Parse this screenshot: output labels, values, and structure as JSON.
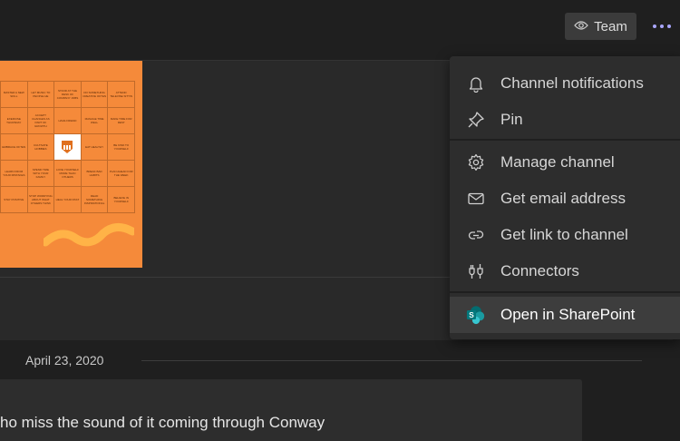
{
  "header": {
    "team_label": "Team"
  },
  "bingo": {
    "cells": [
      "MASTER A NEW SKILL",
      "LET MUSIC TO PEOPLE HE",
      "STAND AT THE DESK OF COMPANY JOBS",
      "DO SOMETHING CREATIVE OFTEN",
      "ATTEND TELEVISE SITTIN",
      "EXERCISE THURSDAY",
      "ACCEPT CHANGES AS PART OF GROWTH",
      "HAVE FRIEND",
      "MANAGE TIME WELL",
      "MAKE TIME FOR REST",
      "EMBRACE OFTEN",
      "CULTIVATE HOBBIES",
      "",
      "EAT HEALTHY",
      "BE KIND TO YOURSELF",
      "LEARN FROM YOUR MISTAKES",
      "SPEND TIME WITH YOUR FAMILY",
      "LOVE YOURSELF MORE THAN OTHERS",
      "BREAK BAD HABITS",
      "PLAN AHEAD FOR THE WEEK",
      "STAY POSITIVE",
      "STOP WORRYING ABOUT WHAT OTHERS THINK",
      "HEAL YOUR PAST",
      "READ SOMETHING INSPIRATIONAL",
      "BELIEVE IN YOURSELF"
    ]
  },
  "conversation": {
    "date": "April 23, 2020",
    "message_text": "ho miss the sound of it coming through Conway"
  },
  "menu": {
    "items": [
      {
        "label": "Channel notifications",
        "icon": "bell-icon"
      },
      {
        "label": "Pin",
        "icon": "pin-icon"
      },
      {
        "label": "Manage channel",
        "icon": "gear-icon"
      },
      {
        "label": "Get email address",
        "icon": "mail-icon"
      },
      {
        "label": "Get link to channel",
        "icon": "link-icon"
      },
      {
        "label": "Connectors",
        "icon": "connectors-icon"
      },
      {
        "label": "Open in SharePoint",
        "icon": "sharepoint-icon"
      }
    ]
  },
  "colors": {
    "accent": "#a9a6ff",
    "bingo_orange": "#f58a3a",
    "sharepoint_teal": "#03787c"
  }
}
